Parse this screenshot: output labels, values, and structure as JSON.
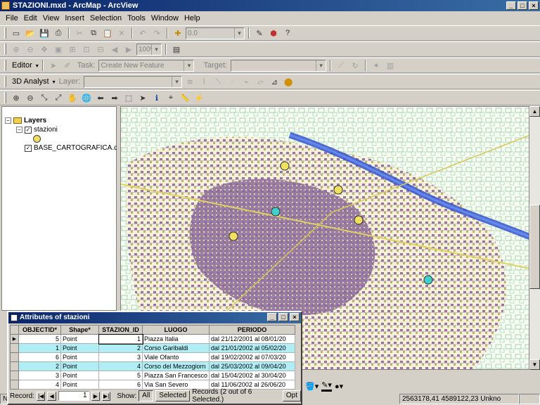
{
  "window": {
    "title": "STAZIONI.mxd - ArcMap - ArcView"
  },
  "menu": [
    "File",
    "Edit",
    "View",
    "Insert",
    "Selection",
    "Tools",
    "Window",
    "Help"
  ],
  "standard_toolbar": {
    "scale_value": "0.0"
  },
  "layout_toolbar": {
    "zoom_value": "100%"
  },
  "editor_toolbar": {
    "editor_label": "Editor",
    "task_label": "Task:",
    "task_value": "Create New Feature",
    "target_label": "Target:"
  },
  "analyst_toolbar": {
    "label": "3D Analyst",
    "layer_label": "Layer:"
  },
  "toc": {
    "root": "Layers",
    "layers": [
      {
        "name": "stazioni",
        "checked": true
      },
      {
        "name": "BASE_CARTOGRAFICA.dwg",
        "checked": true
      }
    ]
  },
  "map": {
    "stations": [
      {
        "color": "#f0e060",
        "selected": false
      },
      {
        "color": "#f0e060",
        "selected": false
      },
      {
        "color": "#40d0d0",
        "selected": true
      },
      {
        "color": "#f0e060",
        "selected": false
      },
      {
        "color": "#f0e060",
        "selected": false
      },
      {
        "color": "#40d0d0",
        "selected": true
      }
    ],
    "colors": {
      "default_point": "#f0e060",
      "selected_point": "#40d0d0",
      "river": "#3355cc"
    }
  },
  "attribute_table": {
    "title": "Attributes of stazioni",
    "columns": [
      "OBJECTID*",
      "Shape*",
      "STAZION_ID",
      "LUOGO",
      "PERIODO"
    ],
    "rows": [
      {
        "objectid": "5",
        "shape": "Point",
        "stazion_id": "1",
        "luogo": "Piazza Italia",
        "periodo": "dal 21/12/2001 al 08/01/20",
        "selected": false,
        "current": true
      },
      {
        "objectid": "1",
        "shape": "Point",
        "stazion_id": "2",
        "luogo": "Corso Garibaldi",
        "periodo": "dal 21/01/2002 al 05/02/20",
        "selected": true,
        "current": false
      },
      {
        "objectid": "6",
        "shape": "Point",
        "stazion_id": "3",
        "luogo": "Viale Ofanto",
        "periodo": "dal 19/02/2002 al 07/03/20",
        "selected": false,
        "current": false
      },
      {
        "objectid": "2",
        "shape": "Point",
        "stazion_id": "4",
        "luogo": "Corso del Mezzogiorn",
        "periodo": "dal 25/03/2002 al 09/04/20",
        "selected": true,
        "current": false
      },
      {
        "objectid": "3",
        "shape": "Point",
        "stazion_id": "5",
        "luogo": "Piazza San Francesco",
        "periodo": "dal 15/04/2002 al 30/04/20",
        "selected": false,
        "current": false
      },
      {
        "objectid": "4",
        "shape": "Point",
        "stazion_id": "6",
        "luogo": "Via San Severo",
        "periodo": "dal 11/06/2002 al 26/06/20",
        "selected": false,
        "current": false
      }
    ],
    "record_label": "Record:",
    "record_value": "1",
    "show_label": "Show:",
    "all_label": "All",
    "selected_label": "Selected",
    "records_text": "Records  (2 out of 6 Selected.)",
    "options_label": "Opt"
  },
  "status": {
    "coords": "2563178,41  4589122,23 Unkno",
    "left": "N"
  }
}
